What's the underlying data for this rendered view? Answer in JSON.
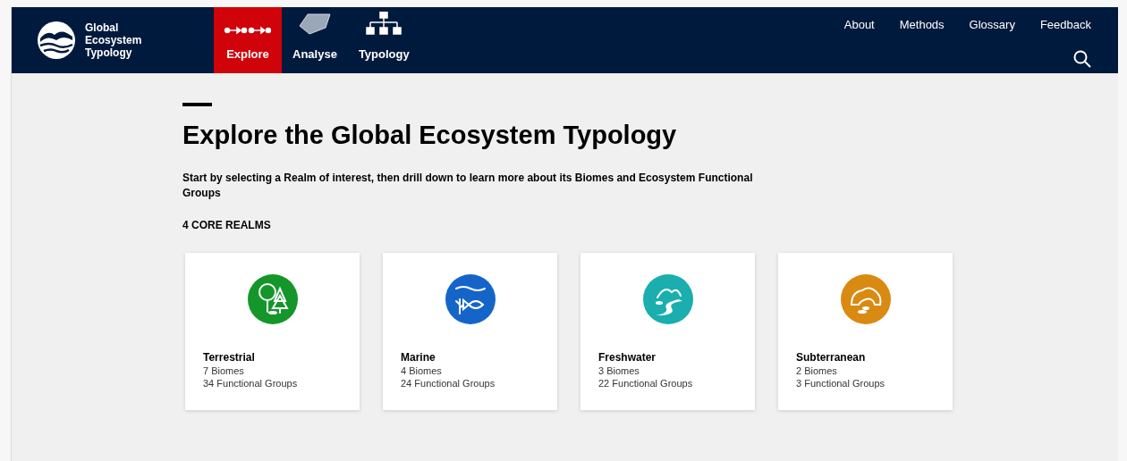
{
  "header": {
    "logo_text": "Global Ecosystem Typology",
    "tabs": [
      {
        "label": "Explore",
        "kind": "path",
        "selected": true
      },
      {
        "label": "Analyse",
        "kind": "shape",
        "selected": false
      },
      {
        "label": "Typology",
        "kind": "tree",
        "selected": false
      }
    ],
    "links": [
      "About",
      "Methods",
      "Glossary",
      "Feedback"
    ]
  },
  "page": {
    "title": "Explore the Global Ecosystem Typology",
    "intro": "Start by selecting a Realm of interest, then drill down to learn more about its Biomes and Ecosystem Functional Groups",
    "section": "4 CORE REALMS",
    "realms": [
      {
        "kind": "terrestrial",
        "color": "#14962b",
        "name": "Terrestrial",
        "biomes": "7 Biomes",
        "groups": "34 Functional Groups"
      },
      {
        "kind": "marine",
        "color": "#1565c9",
        "name": "Marine",
        "biomes": "4 Biomes",
        "groups": "24 Functional Groups"
      },
      {
        "kind": "freshwater",
        "color": "#1aaeae",
        "name": "Freshwater",
        "biomes": "3 Biomes",
        "groups": "22 Functional Groups"
      },
      {
        "kind": "subterranean",
        "color": "#d98a12",
        "name": "Subterranean",
        "biomes": "2 Biomes",
        "groups": "3 Functional Groups"
      }
    ]
  }
}
